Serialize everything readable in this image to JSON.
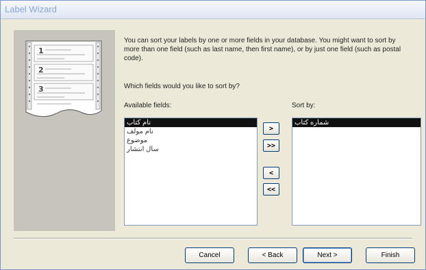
{
  "window": {
    "title": "Label Wizard"
  },
  "intro_text": "You can sort your labels by one or more fields in your database.  You might want to sort by more than one field (such as last name, then first name), or by just one field (such as postal code).",
  "question": "Which fields would you like to sort by?",
  "available": {
    "label": "Available fields:",
    "items": [
      "نام كتاب",
      "نام مولف",
      "موضوع",
      "سال انتشار"
    ],
    "selected_index": 0
  },
  "sort_by": {
    "label": "Sort by:",
    "items": [
      "شماره كتاب"
    ],
    "selected_index": 0
  },
  "move_buttons": {
    "add_one": ">",
    "add_all": ">>",
    "remove_one": "<",
    "remove_all": "<<"
  },
  "nav": {
    "cancel": "Cancel",
    "back": "< Back",
    "next": "Next >",
    "finish": "Finish"
  },
  "icons": {
    "illustration": "label-sheet-illustration-icon"
  }
}
